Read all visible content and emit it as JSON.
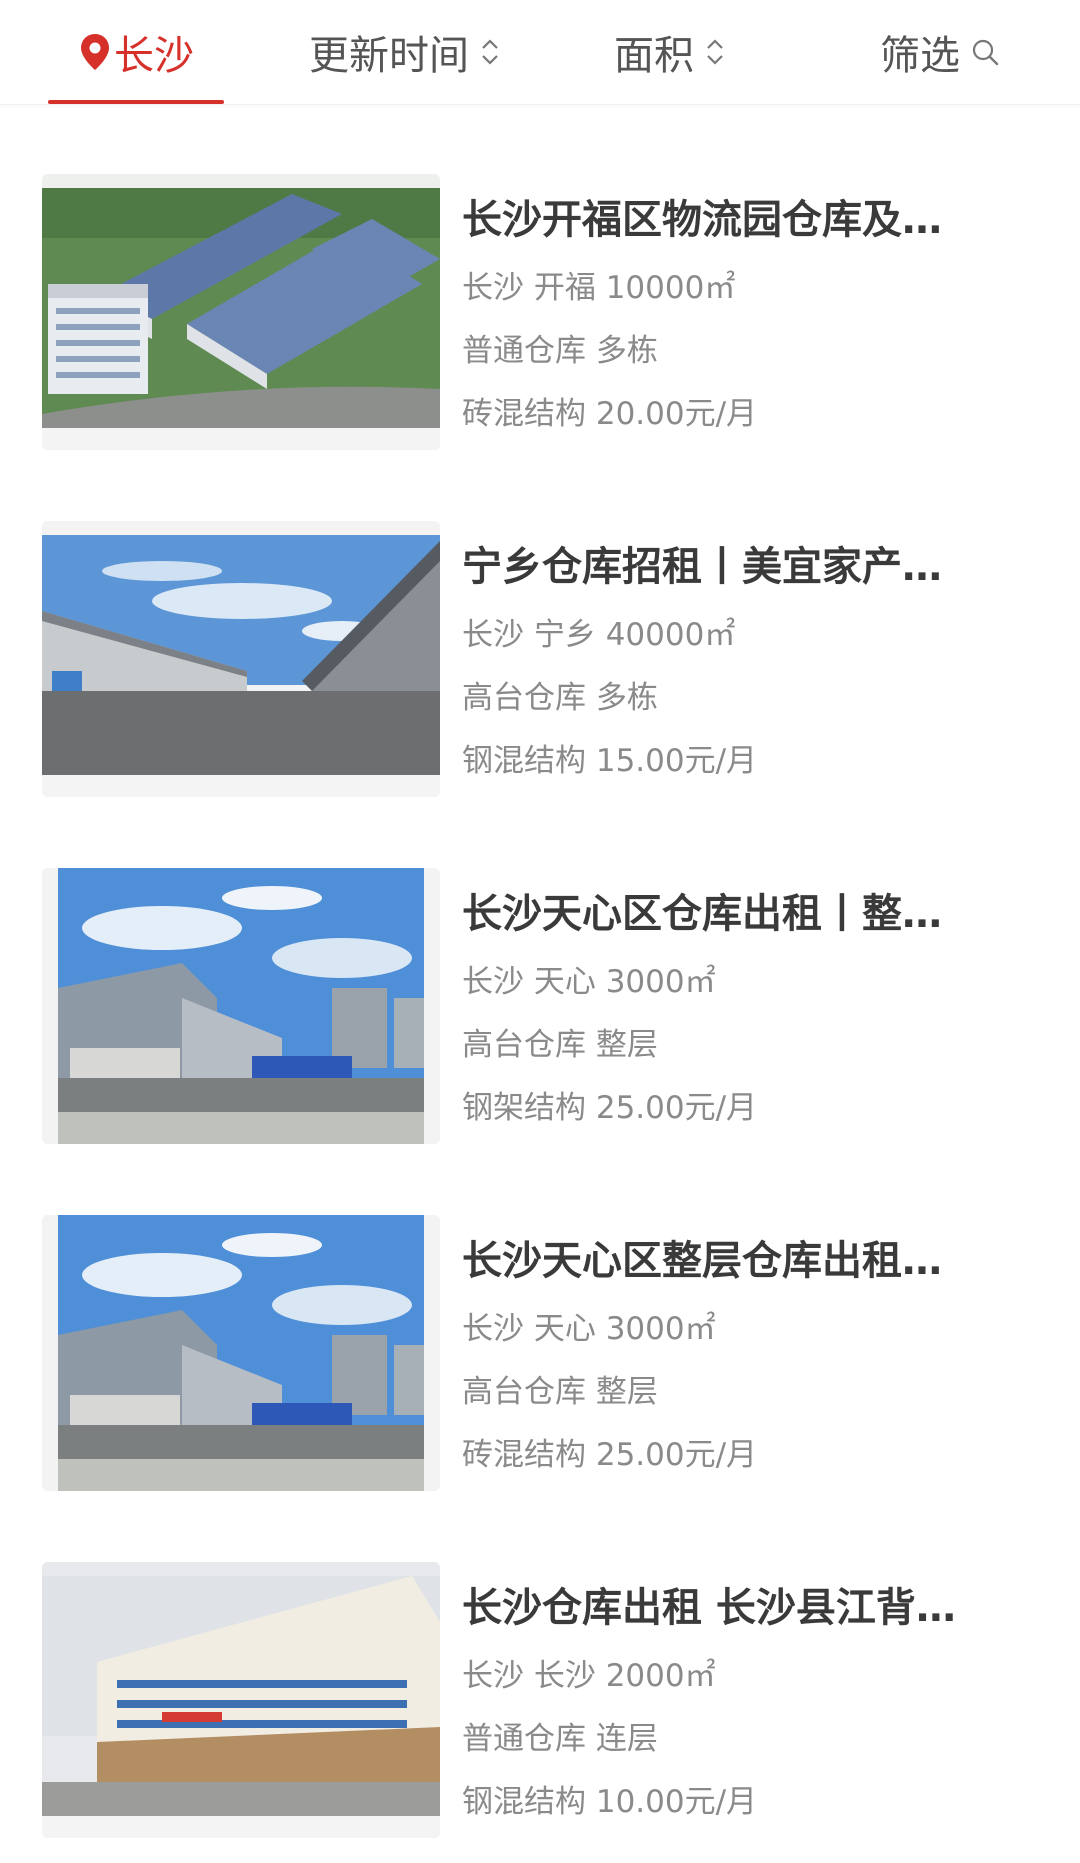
{
  "filter_bar": {
    "city_label": "长沙",
    "update_time_label": "更新时间",
    "area_label": "面积",
    "filter_label": "筛选",
    "accent_color": "#d6302a"
  },
  "listings": [
    {
      "title": "长沙开福区物流园仓库及…",
      "location": "长沙 开福 10000㎡",
      "type": "普通仓库 多栋",
      "structure_price": "砖混结构 20.00元/月",
      "image": "aerial-warehouse-park"
    },
    {
      "title": "宁乡仓库招租丨美宜家产…",
      "location": "长沙 宁乡 40000㎡",
      "type": "高台仓库 多栋",
      "structure_price": "钢混结构 15.00元/月",
      "image": "loading-dock-yard"
    },
    {
      "title": "长沙天心区仓库出租丨整…",
      "location": "长沙 天心 3000㎡",
      "type": "高台仓库 整层",
      "structure_price": "钢架结构 25.00元/月",
      "image": "warehouse-with-gate"
    },
    {
      "title": "长沙天心区整层仓库出租…",
      "location": "长沙 天心 3000㎡",
      "type": "高台仓库 整层",
      "structure_price": "砖混结构 25.00元/月",
      "image": "warehouse-with-gate"
    },
    {
      "title": "长沙仓库出租 长沙县江背…",
      "location": "长沙 长沙 2000㎡",
      "type": "普通仓库 连层",
      "structure_price": "钢混结构 10.00元/月",
      "image": "multi-storey-building"
    }
  ]
}
